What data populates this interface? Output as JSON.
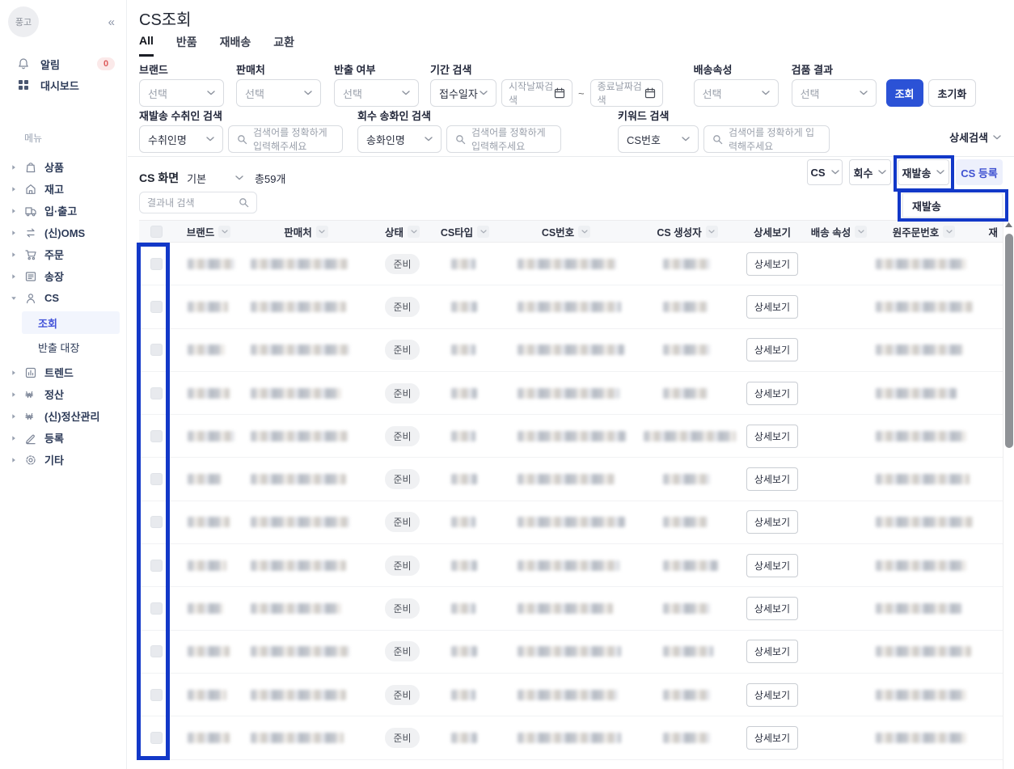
{
  "colors": {
    "accent": "#2b52d6",
    "annotation": "#1238c8",
    "active_link": "#4353d9",
    "badge_red": "#dd5b5b"
  },
  "logo": {
    "text": "풍고",
    "collapse_glyph": "«"
  },
  "sidebar": {
    "notification": {
      "label": "알림",
      "badge": "0"
    },
    "dashboard": {
      "label": "대시보드"
    },
    "menu_caption": "메뉴",
    "items": [
      {
        "icon": "bag-icon",
        "label": "상품"
      },
      {
        "icon": "home-icon",
        "label": "재고"
      },
      {
        "icon": "truck-icon",
        "label": "입·출고"
      },
      {
        "icon": "swap-icon",
        "label": "(신)OMS"
      },
      {
        "icon": "cart-icon",
        "label": "주문"
      },
      {
        "icon": "invoice-icon",
        "label": "송장"
      },
      {
        "icon": "person-icon",
        "label": "CS",
        "expanded": true,
        "children": [
          {
            "label": "조회",
            "active": true
          },
          {
            "label": "반출 대장",
            "active": false
          }
        ]
      },
      {
        "icon": "trend-icon",
        "label": "트렌드"
      },
      {
        "icon": "won-icon",
        "label": "정산"
      },
      {
        "icon": "won-icon",
        "label": "(신)정산관리"
      },
      {
        "icon": "pencil-icon",
        "label": "등록"
      },
      {
        "icon": "gear-icon",
        "label": "기타"
      }
    ]
  },
  "page": {
    "title": "CS조회",
    "tabs": [
      {
        "label": "All",
        "active": true
      },
      {
        "label": "반품",
        "active": false
      },
      {
        "label": "재배송",
        "active": false
      },
      {
        "label": "교환",
        "active": false
      }
    ]
  },
  "filters": {
    "brand": {
      "label": "브랜드",
      "value": "선택"
    },
    "seller": {
      "label": "판매처",
      "value": "선택"
    },
    "carryout": {
      "label": "반출 여부",
      "value": "선택"
    },
    "period": {
      "label": "기간 검색",
      "type_value": "접수일자",
      "start_placeholder": "시작날짜검색",
      "tilde": "~",
      "end_placeholder": "종료날짜검색"
    },
    "delivery": {
      "label": "배송속성",
      "value": "선택"
    },
    "inspection": {
      "label": "검품 결과",
      "value": "선택"
    },
    "search_button": "조회",
    "reset_button": "초기화",
    "resend_receiver": {
      "label": "재발송 수취인 검색",
      "type_value": "수취인명",
      "placeholder": "검색어를 정확하게 입력해주세요"
    },
    "retrieve_sender": {
      "label": "회수 송화인 검색",
      "type_value": "송화인명",
      "placeholder": "검색어를 정확하게 입력해주세요"
    },
    "keyword": {
      "label": "키워드 검색",
      "type_value": "CS번호",
      "placeholder": "검색어를 정확하게 입력해주세요"
    },
    "detail_toggle": "상세검색"
  },
  "toolbar": {
    "screen_label": "CS 화면",
    "screen_value": "기본",
    "total_count": "총59개",
    "result_search_placeholder": "결과내 검색",
    "cs_button": "CS",
    "recall_button": "회수",
    "resend_button": "재발송",
    "register_button": "CS 등록",
    "dropdown_item": "재발송"
  },
  "table": {
    "columns": [
      {
        "key": "check",
        "label": "",
        "filter": false,
        "checkbox": true
      },
      {
        "key": "brand",
        "label": "브랜드",
        "filter": true
      },
      {
        "key": "seller",
        "label": "판매처",
        "filter": true
      },
      {
        "key": "status",
        "label": "상태",
        "filter": true
      },
      {
        "key": "cstype",
        "label": "CS타입",
        "filter": true
      },
      {
        "key": "csno",
        "label": "CS번호",
        "filter": true
      },
      {
        "key": "creator",
        "label": "CS 생성자",
        "filter": true
      },
      {
        "key": "detail",
        "label": "상세보기",
        "filter": false
      },
      {
        "key": "delivery",
        "label": "배송 속성",
        "filter": true
      },
      {
        "key": "orderno",
        "label": "원주문번호",
        "filter": true
      },
      {
        "key": "resend",
        "label": "재",
        "filter": false
      }
    ],
    "status_value": "준비",
    "detail_button_label": "상세보기",
    "rows": [
      {
        "masked": true,
        "status": "준비",
        "brand_w": 58,
        "seller_w": 120,
        "cstype_w": 30,
        "csno_w": 122,
        "creator_w": 58,
        "orderno_w": 112
      },
      {
        "masked": true,
        "status": "준비",
        "brand_w": 50,
        "seller_w": 118,
        "cstype_w": 32,
        "csno_w": 128,
        "creator_w": 55,
        "orderno_w": 120
      },
      {
        "masked": true,
        "status": "준비",
        "brand_w": 46,
        "seller_w": 122,
        "cstype_w": 30,
        "csno_w": 132,
        "creator_w": 58,
        "orderno_w": 108
      },
      {
        "masked": true,
        "status": "준비",
        "brand_w": 52,
        "seller_w": 112,
        "cstype_w": 32,
        "csno_w": 126,
        "creator_w": 55,
        "orderno_w": 100
      },
      {
        "masked": true,
        "status": "준비",
        "brand_w": 58,
        "seller_w": 120,
        "cstype_w": 30,
        "csno_w": 134,
        "creator_w": 114,
        "orderno_w": 112,
        "creator_wide": true
      },
      {
        "masked": true,
        "status": "준비",
        "brand_w": 42,
        "seller_w": 118,
        "cstype_w": 32,
        "csno_w": 120,
        "creator_w": 58,
        "orderno_w": 116
      },
      {
        "masked": true,
        "status": "준비",
        "brand_w": 52,
        "seller_w": 122,
        "cstype_w": 30,
        "csno_w": 133,
        "creator_w": 55,
        "orderno_w": 120
      },
      {
        "masked": true,
        "status": "준비",
        "brand_w": 48,
        "seller_w": 118,
        "cstype_w": 32,
        "csno_w": 126,
        "creator_w": 68,
        "orderno_w": 112
      },
      {
        "masked": true,
        "status": "준비",
        "brand_w": 44,
        "seller_w": 112,
        "cstype_w": 30,
        "csno_w": 118,
        "creator_w": 58,
        "orderno_w": 106
      },
      {
        "masked": true,
        "status": "준비",
        "brand_w": 52,
        "seller_w": 122,
        "cstype_w": 32,
        "csno_w": 128,
        "creator_w": 62,
        "orderno_w": 118
      },
      {
        "masked": true,
        "status": "준비",
        "brand_w": 48,
        "seller_w": 118,
        "cstype_w": 30,
        "csno_w": 124,
        "creator_w": 58,
        "orderno_w": 112
      },
      {
        "masked": true,
        "status": "준비",
        "brand_w": 52,
        "seller_w": 115,
        "cstype_w": 32,
        "csno_w": 128,
        "creator_w": 58,
        "orderno_w": 112
      }
    ]
  }
}
